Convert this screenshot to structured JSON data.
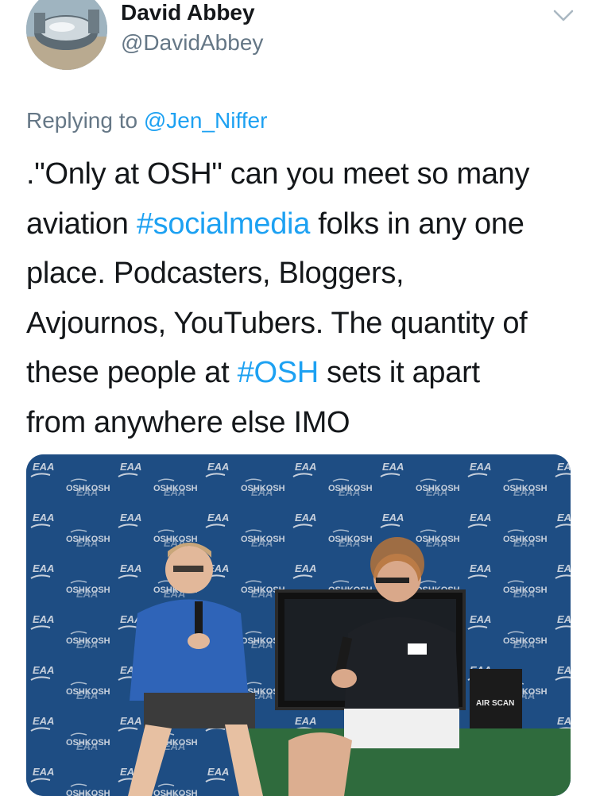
{
  "author": {
    "name": "David Abbey",
    "handle": "@DavidAbbey"
  },
  "reply": {
    "prefix": "Replying to",
    "mention": "@Jen_Niffer"
  },
  "tweet": {
    "line1": ".\"Only at OSH\" can you meet so many",
    "line2_pre": "aviation ",
    "line2_tag": "#socialmedia",
    "line2_post": " folks in any one",
    "line3": "place. Podcasters, Bloggers,",
    "line4": "Avjournos, YouTubers. The quantity of",
    "line5_pre": "these people at ",
    "line5_tag": "#OSH",
    "line5_post": " sets it apart",
    "line6": "from anywhere else IMO"
  },
  "photo": {
    "backdrop_logos": [
      "EAA",
      "OSHKOSH"
    ],
    "sign_text": "AIR SCAN"
  },
  "colors": {
    "link": "#1da1f2",
    "secondary": "#657786",
    "backdrop": "#1f4f86"
  },
  "icons": [
    "chevron-down-icon"
  ]
}
